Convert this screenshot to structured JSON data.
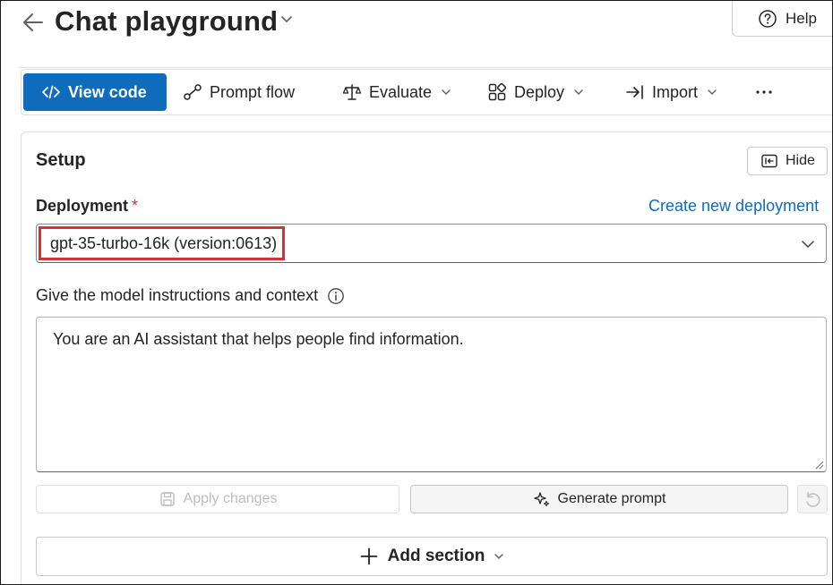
{
  "header": {
    "title": "Chat playground",
    "help_label": "Help"
  },
  "toolbar": {
    "view_code": "View code",
    "prompt_flow": "Prompt flow",
    "evaluate": "Evaluate",
    "deploy": "Deploy",
    "import": "Import"
  },
  "setup": {
    "title": "Setup",
    "hide_label": "Hide",
    "deployment_label": "Deployment",
    "required_mark": "*",
    "create_link": "Create new deployment",
    "deployment_value": "gpt-35-turbo-16k (version:0613)",
    "instructions_label": "Give the model instructions and context",
    "instructions_text": "You are an AI assistant that helps people find information.",
    "apply_label": "Apply changes",
    "generate_label": "Generate prompt",
    "add_section_label": "Add section"
  },
  "colors": {
    "accent": "#0f6cbd",
    "highlight_box": "#d13438",
    "required": "#c4314b"
  }
}
